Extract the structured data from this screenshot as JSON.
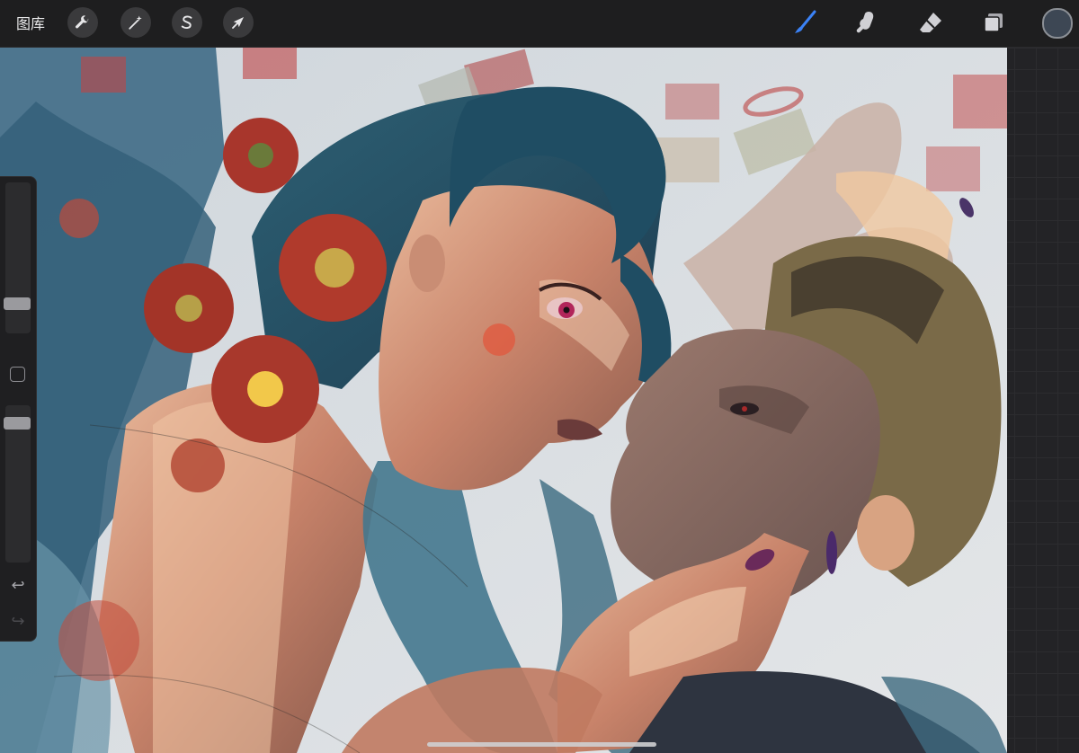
{
  "toolbar": {
    "gallery_label": "图库",
    "left_tools": [
      {
        "name": "actions",
        "icon": "wrench-icon"
      },
      {
        "name": "adjustments",
        "icon": "magic-wand-icon"
      },
      {
        "name": "selection",
        "icon": "selection-s-icon"
      },
      {
        "name": "transform",
        "icon": "arrow-cursor-icon"
      }
    ],
    "right_tools": [
      {
        "name": "brush",
        "icon": "brush-icon",
        "active": true,
        "color": "#3b82f6"
      },
      {
        "name": "smudge",
        "icon": "smudge-finger-icon"
      },
      {
        "name": "eraser",
        "icon": "eraser-icon"
      },
      {
        "name": "layers",
        "icon": "layers-icon"
      }
    ],
    "current_color": "#3d4754"
  },
  "sidebar": {
    "brush_size_level": 0.17,
    "opacity_level": 0.92,
    "modify_icon": "square-icon",
    "undo_icon": "undo-arrow-icon",
    "redo_icon": "redo-arrow-icon"
  }
}
